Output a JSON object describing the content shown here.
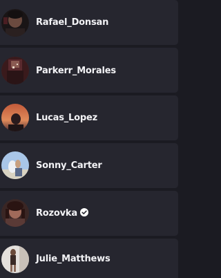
{
  "users": [
    {
      "name": "Rafael_Donsan",
      "verified": false
    },
    {
      "name": "Parkerr_Morales",
      "verified": false
    },
    {
      "name": "Lucas_Lopez",
      "verified": false
    },
    {
      "name": "Sonny_Carter",
      "verified": false
    },
    {
      "name": "Rozovka",
      "verified": true
    },
    {
      "name": "Julie_Matthews",
      "verified": false
    }
  ],
  "colors": {
    "background": "#1b1b22",
    "row": "#26262f",
    "text": "#f2f2f5",
    "verified_badge": "#ffffff"
  },
  "icons": {
    "verified": "verified-check-icon"
  }
}
